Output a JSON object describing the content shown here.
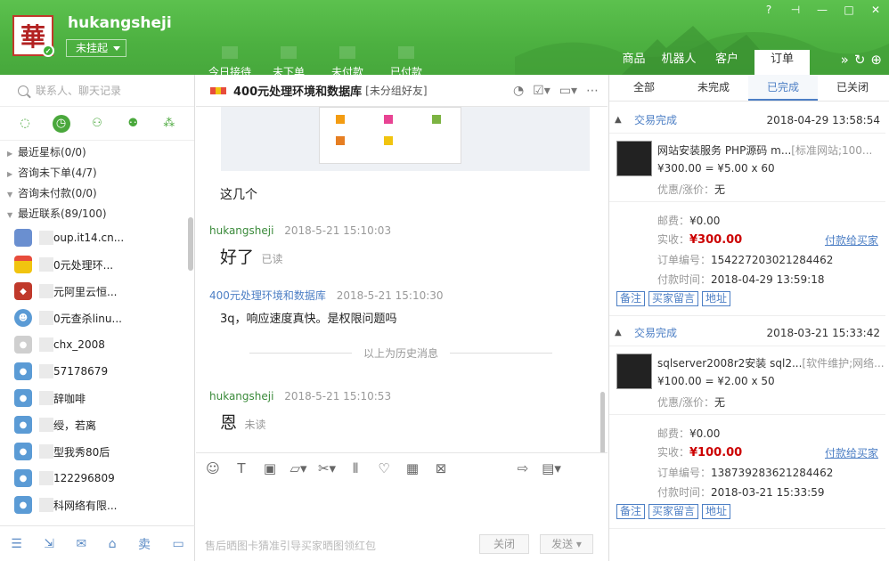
{
  "header": {
    "logo_char": "華",
    "username": "hukangsheji",
    "status": "未挂起",
    "stats": [
      "今日接待",
      "未下单",
      "未付款",
      "已付款"
    ],
    "tabs": [
      "商品",
      "机器人",
      "客户",
      "订单"
    ],
    "win_controls": [
      "?",
      "⊣",
      "—",
      "□",
      "✕"
    ],
    "more_icons": [
      "»",
      "↻",
      "⊕"
    ]
  },
  "left": {
    "search_placeholder": "联系人、聊天记录",
    "groups": [
      {
        "label": "最近星标(0/0)",
        "open": false
      },
      {
        "label": "咨询未下单(4/7)",
        "open": false
      },
      {
        "label": "咨询未付款(0/0)",
        "open": true
      },
      {
        "label": "最近联系(89/100)",
        "open": true
      }
    ],
    "contacts": [
      {
        "name": "oup.it14.cn...",
        "color": "#6a8fd0"
      },
      {
        "name": "0元处理环...",
        "color": "#e74c3c"
      },
      {
        "name": "元阿里云恒...",
        "color": "#c0392b"
      },
      {
        "name": "0元查杀linu...",
        "color": "#5b9bd5"
      },
      {
        "name": "chx_2008",
        "color": "#cfcfcf"
      },
      {
        "name": "57178679",
        "color": "#5b9bd5"
      },
      {
        "name": "辞咖啡",
        "color": "#5b9bd5"
      },
      {
        "name": "绶，若离",
        "color": "#5b9bd5"
      },
      {
        "name": "型我秀80后",
        "color": "#5b9bd5"
      },
      {
        "name": "122296809",
        "color": "#5b9bd5"
      },
      {
        "name": "科网络有限...",
        "color": "#5b9bd5"
      }
    ]
  },
  "chat": {
    "title": "400元处理环境和数据库",
    "group": "[未分组好友]",
    "messages": {
      "m1_text": "这几个",
      "m2_who": "hukangsheji",
      "m2_time": "2018-5-21 15:10:03",
      "m2_text": "好了",
      "m2_read": "已读",
      "m3_who": "400元处理环境和数据库",
      "m3_time": "2018-5-21 15:10:30",
      "m3_text": "3q，响应速度真快。是权限问题吗",
      "history": "以上为历史消息",
      "m4_who": "hukangsheji",
      "m4_time": "2018-5-21 15:10:53",
      "m4_text": "恩",
      "m4_read": "未读"
    },
    "hint": "售后晒图卡猜准引导买家晒图领红包",
    "close_label": "关闭",
    "send_label": "发送"
  },
  "orders": {
    "tabs": [
      "全部",
      "未完成",
      "已完成",
      "已关闭"
    ],
    "items": [
      {
        "status": "交易完成",
        "time": "2018-04-29 13:58:54",
        "title": "网站安装服务 PHP源码 m...",
        "tag": "[标准网站;100...",
        "price": "¥300.00 = ¥5.00 x 60",
        "discount_label": "优惠/涨价：",
        "discount": "无",
        "postage_label": "邮费：",
        "postage": "¥0.00",
        "paid_label": "实收：",
        "paid": "¥300.00",
        "pay_link": "付款给买家",
        "order_no_label": "订单编号：",
        "order_no": "154227203021284462",
        "pay_time_label": "付款时间：",
        "pay_time": "2018-04-29 13:59:18",
        "buttons": [
          "备注",
          "买家留言",
          "地址"
        ]
      },
      {
        "status": "交易完成",
        "time": "2018-03-21 15:33:42",
        "title": "sqlserver2008r2安装 sql2...",
        "tag": "[软件维护;网络...",
        "price": "¥100.00 = ¥2.00 x 50",
        "discount_label": "优惠/涨价：",
        "discount": "无",
        "postage_label": "邮费：",
        "postage": "¥0.00",
        "paid_label": "实收：",
        "paid": "¥100.00",
        "pay_link": "付款给买家",
        "order_no_label": "订单编号：",
        "order_no": "138739283621284462",
        "pay_time_label": "付款时间：",
        "pay_time": "2018-03-21 15:33:59",
        "buttons": [
          "备注",
          "买家留言",
          "地址"
        ]
      }
    ]
  }
}
